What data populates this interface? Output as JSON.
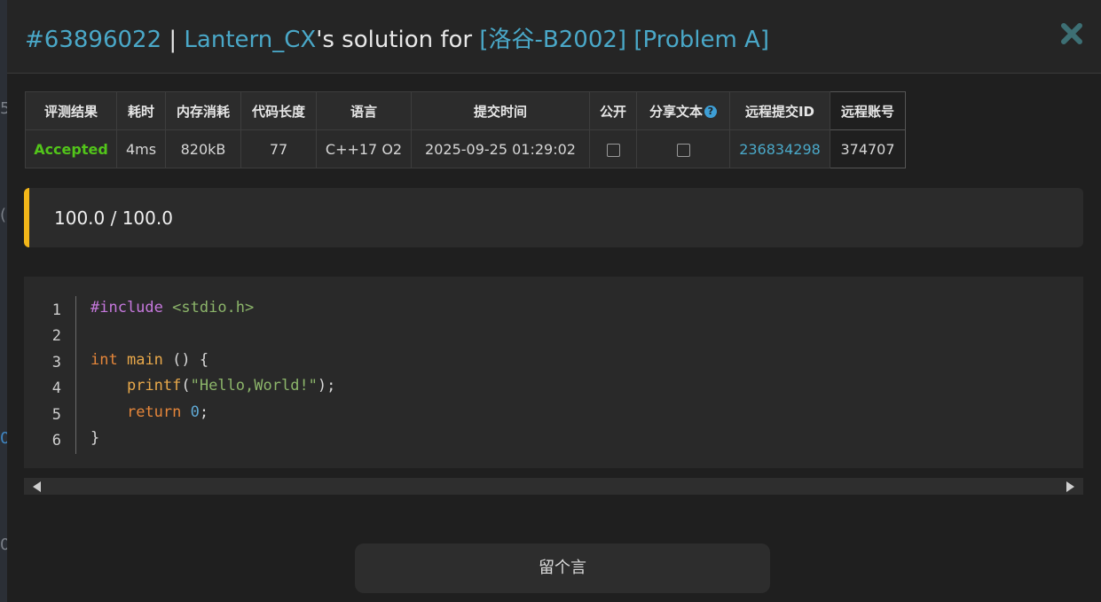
{
  "header": {
    "record_id": "#63896022",
    "separator": " | ",
    "user": "Lantern_CX",
    "solution_text": "'s solution for ",
    "problem_code": "[洛谷-B2002]",
    "problem_name": "[Problem A]"
  },
  "table": {
    "headers": [
      "评测结果",
      "耗时",
      "内存消耗",
      "代码长度",
      "语言",
      "提交时间",
      "公开",
      "分享文本",
      "远程提交ID",
      "远程账号"
    ],
    "row": {
      "result": "Accepted",
      "time": "4ms",
      "memory": "820kB",
      "code_length": "77",
      "language": "C++17 O2",
      "submit_time": "2025-09-25 01:29:02",
      "public_checked": false,
      "share_checked": false,
      "remote_id": "236834298",
      "remote_account": "374707"
    }
  },
  "score": "100.0 / 100.0",
  "code": {
    "line_numbers": [
      "1",
      "2",
      "3",
      "4",
      "5",
      "6"
    ]
  },
  "comment_button": "留个言",
  "colors": {
    "accent_link": "#4aa8c8",
    "accepted": "#52c41a",
    "score_bar": "#f2b619"
  },
  "background_glyphs": [
    "5",
    "(",
    "0",
    "0"
  ]
}
